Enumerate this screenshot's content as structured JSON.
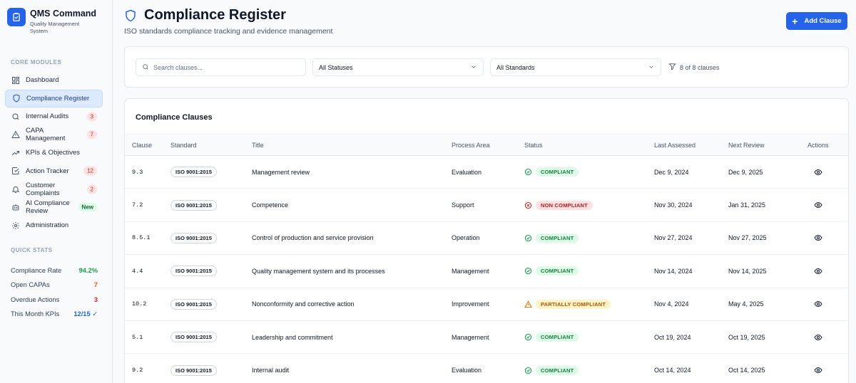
{
  "brand": {
    "name": "QMS Command",
    "subtitle": "Quality Management System",
    "logo_icon": "clipboard-check-icon",
    "color": "#2563eb"
  },
  "sidebar": {
    "core_label": "CORE MODULES",
    "items": [
      {
        "label": "Dashboard",
        "icon": "grid-icon",
        "badge": ""
      },
      {
        "label": "Compliance Register",
        "icon": "shield-icon",
        "badge": "",
        "active": true
      },
      {
        "label": "Internal Audits",
        "icon": "search-icon",
        "badge": "3"
      },
      {
        "label": "CAPA Management",
        "icon": "alert-triangle-icon",
        "badge": "7"
      },
      {
        "label": "KPIs & Objectives",
        "icon": "trending-up-icon",
        "badge": ""
      },
      {
        "label": "Action Tracker",
        "icon": "check-square-icon",
        "badge": "12"
      },
      {
        "label": "Customer Complaints",
        "icon": "bell-icon",
        "badge": "2"
      },
      {
        "label": "AI Compliance Review",
        "icon": "bot-icon",
        "badge": "New"
      },
      {
        "label": "Administration",
        "icon": "gear-icon",
        "badge": ""
      }
    ],
    "quick_label": "QUICK STATS",
    "stats": [
      {
        "label": "Compliance Rate",
        "value": "94.2%",
        "color": "#16a34a"
      },
      {
        "label": "Open CAPAs",
        "value": "7",
        "color": "#ea580c"
      },
      {
        "label": "Overdue Actions",
        "value": "3",
        "color": "#dc2626"
      },
      {
        "label": "This Month KPIs",
        "value": "12/15 ✓",
        "color": "#2563eb"
      }
    ]
  },
  "header": {
    "title": "Compliance Register",
    "subtitle": "ISO standards compliance tracking and evidence management",
    "add_label": "Add Clause"
  },
  "filters": {
    "search_placeholder": "Search clauses...",
    "status_value": "All Statuses",
    "standard_value": "All Standards",
    "count_text": "8 of 8 clauses"
  },
  "table": {
    "title": "Compliance Clauses",
    "columns": [
      "Clause",
      "Standard",
      "Title",
      "Process Area",
      "Status",
      "Last Assessed",
      "Next Review",
      "Actions"
    ],
    "rows": [
      {
        "clause": "9.3",
        "standard": "ISO 9001:2015",
        "title": "Management review",
        "area": "Evaluation",
        "status": "COMPLIANT",
        "kind": "ok",
        "last": "Dec 9, 2024",
        "next": "Dec 9, 2025"
      },
      {
        "clause": "7.2",
        "standard": "ISO 9001:2015",
        "title": "Competence",
        "area": "Support",
        "status": "NON COMPLIANT",
        "kind": "bad",
        "last": "Nov 30, 2024",
        "next": "Jan 31, 2025"
      },
      {
        "clause": "8.5.1",
        "standard": "ISO 9001:2015",
        "title": "Control of production and service provision",
        "area": "Operation",
        "status": "COMPLIANT",
        "kind": "ok",
        "last": "Nov 27, 2024",
        "next": "Nov 27, 2025"
      },
      {
        "clause": "4.4",
        "standard": "ISO 9001:2015",
        "title": "Quality management system and its processes",
        "area": "Management",
        "status": "COMPLIANT",
        "kind": "ok",
        "last": "Nov 14, 2024",
        "next": "Nov 14, 2025"
      },
      {
        "clause": "10.2",
        "standard": "ISO 9001:2015",
        "title": "Nonconformity and corrective action",
        "area": "Improvement",
        "status": "PARTIALLY COMPLIANT",
        "kind": "partial",
        "last": "Nov 4, 2024",
        "next": "May 4, 2025"
      },
      {
        "clause": "5.1",
        "standard": "ISO 9001:2015",
        "title": "Leadership and commitment",
        "area": "Management",
        "status": "COMPLIANT",
        "kind": "ok",
        "last": "Oct 19, 2024",
        "next": "Oct 19, 2025"
      },
      {
        "clause": "9.2",
        "standard": "ISO 9001:2015",
        "title": "Internal audit",
        "area": "Evaluation",
        "status": "COMPLIANT",
        "kind": "ok",
        "last": "Oct 14, 2024",
        "next": "Oct 14, 2025"
      }
    ]
  },
  "status_colors": {
    "ok": {
      "bg": "#dcfce7",
      "fg": "#15803d",
      "icon": "check-circle-icon"
    },
    "bad": {
      "bg": "#fee2e2",
      "fg": "#b91c1c",
      "icon": "x-circle-icon"
    },
    "partial": {
      "bg": "#fef3c7",
      "fg": "#b45309",
      "icon": "alert-triangle-icon"
    }
  }
}
